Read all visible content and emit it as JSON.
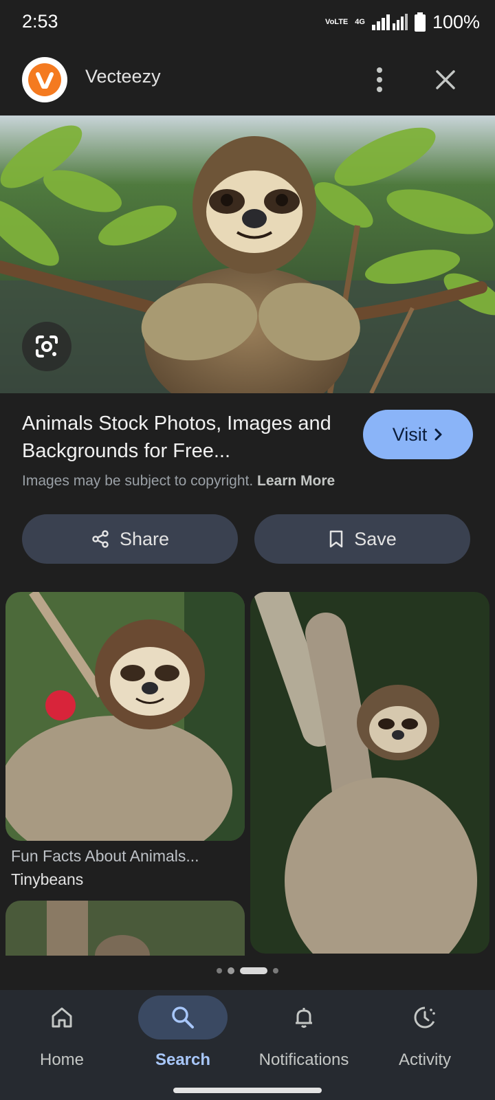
{
  "status_bar": {
    "time": "2:53",
    "network_top": "VoLTE",
    "network_gen": "4G",
    "battery": "100%"
  },
  "header": {
    "site_name": "Vecteezy",
    "logo_letter": "v"
  },
  "result": {
    "title": "Animals Stock Photos, Images and Backgrounds for Free...",
    "copyright_text": "Images may be subject to copyright.",
    "learn_more": "Learn More",
    "visit_label": "Visit"
  },
  "actions": {
    "share_label": "Share",
    "save_label": "Save"
  },
  "related": [
    {
      "title": "Fun Facts About Animals...",
      "source": "Tinybeans"
    }
  ],
  "bottom_nav": {
    "items": [
      {
        "label": "Home",
        "icon": "home-icon"
      },
      {
        "label": "Search",
        "icon": "search-icon",
        "active": true
      },
      {
        "label": "Notifications",
        "icon": "bell-icon"
      },
      {
        "label": "Activity",
        "icon": "activity-icon"
      }
    ]
  },
  "colors": {
    "accent": "#8ab4f8",
    "background": "#1f1f1f",
    "pill": "#3a4150",
    "logo": "#f47a20"
  }
}
